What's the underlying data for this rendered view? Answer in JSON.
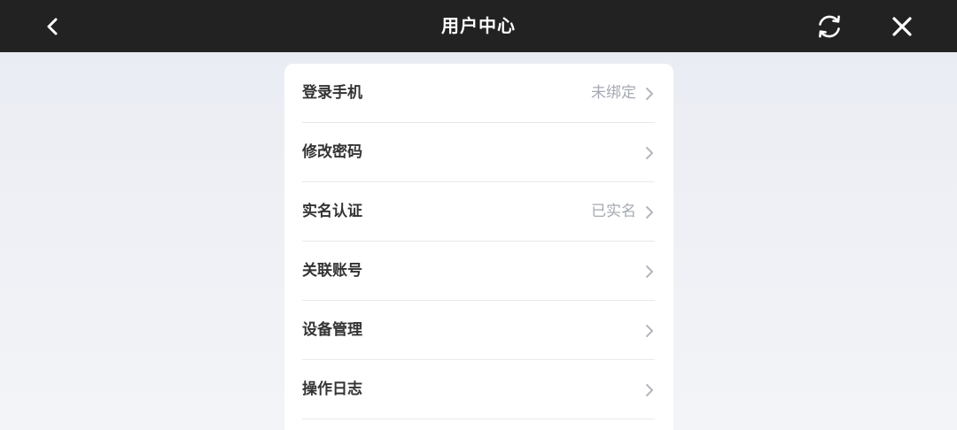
{
  "header": {
    "title": "用户中心",
    "back_icon": "chevron-left-icon",
    "refresh_icon": "refresh-icon",
    "close_icon": "close-icon",
    "background": "#222222"
  },
  "menu": {
    "items": [
      {
        "label": "登录手机",
        "value": "未绑定"
      },
      {
        "label": "修改密码",
        "value": ""
      },
      {
        "label": "实名认证",
        "value": "已实名"
      },
      {
        "label": "关联账号",
        "value": ""
      },
      {
        "label": "设备管理",
        "value": ""
      },
      {
        "label": "操作日志",
        "value": ""
      }
    ]
  }
}
